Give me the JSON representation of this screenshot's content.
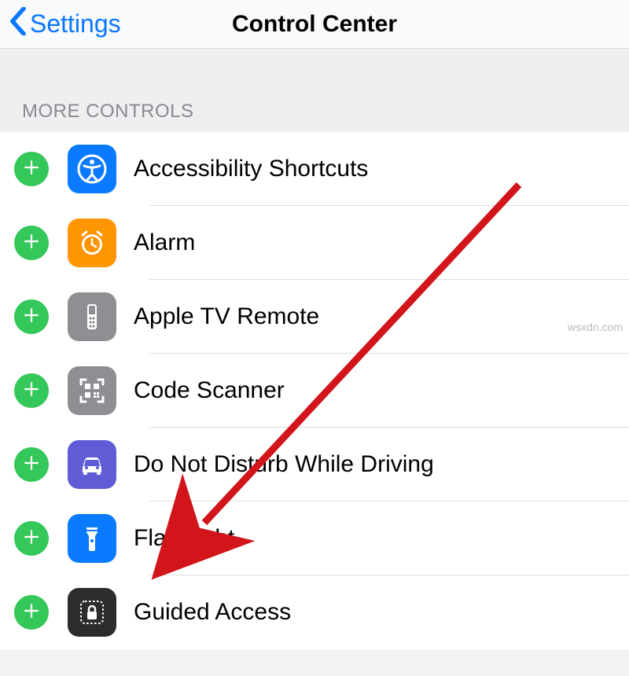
{
  "nav": {
    "back_label": "Settings",
    "title": "Control Center"
  },
  "section": {
    "header": "MORE CONTROLS"
  },
  "controls": [
    {
      "label": "Accessibility Shortcuts",
      "icon": "accessibility-icon",
      "bg": "bg-blue"
    },
    {
      "label": "Alarm",
      "icon": "alarm-icon",
      "bg": "bg-orange"
    },
    {
      "label": "Apple TV Remote",
      "icon": "remote-icon",
      "bg": "bg-gray"
    },
    {
      "label": "Code Scanner",
      "icon": "qr-icon",
      "bg": "bg-gray"
    },
    {
      "label": "Do Not Disturb While Driving",
      "icon": "car-icon",
      "bg": "bg-purple"
    },
    {
      "label": "Flashlight",
      "icon": "flashlight-icon",
      "bg": "bg-blue"
    },
    {
      "label": "Guided Access",
      "icon": "lock-dotted-icon",
      "bg": "bg-dark"
    }
  ],
  "annotation": {
    "arrow_color": "#d2151a"
  },
  "watermark": "wsxdn.com"
}
